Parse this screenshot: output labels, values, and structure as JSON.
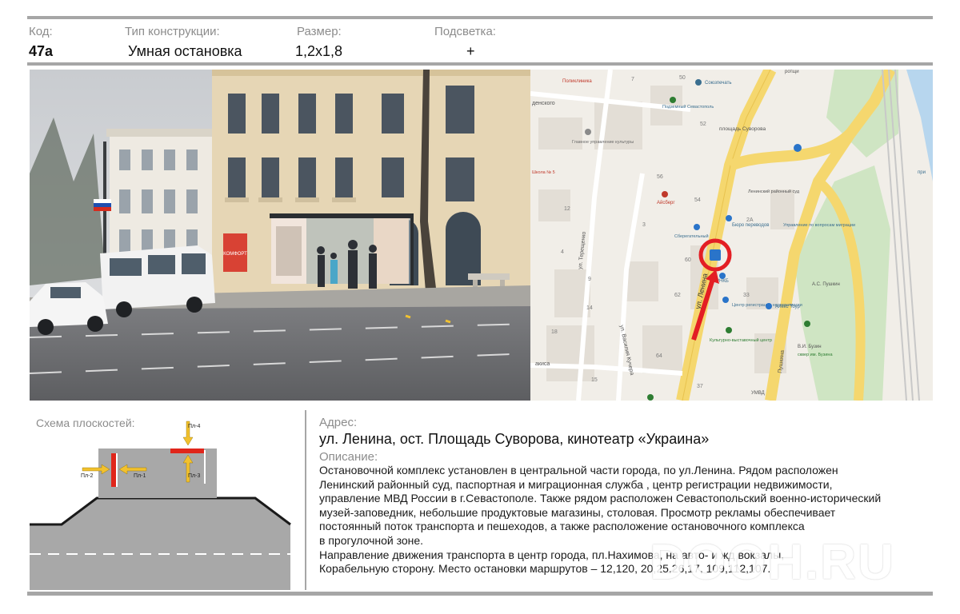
{
  "header": {
    "code_label": "Код:",
    "code_value": "47а",
    "type_label": "Тип конструкции:",
    "type_value": "Умная остановка",
    "size_label": "Размер:",
    "size_value": "1,2х1,8",
    "light_label": "Подсветка:",
    "light_value": "+"
  },
  "photo": {
    "storefront_sign": "КОМФОРТ"
  },
  "map": {
    "labels": {
      "poliklinika": "Поликлиника",
      "soyuzpechat": "Союзпечать",
      "podzemny": "Подземный Севастополь",
      "glavnoe": "Главное управление культуры",
      "ploshchad": "площадь Суворова",
      "school": "Школа № 5",
      "aysberg": "Айсберг",
      "leninsky": "Ленинский районный суд",
      "byuro": "Бюро переводов",
      "upravlenie": "Управление по вопросам миграции",
      "sberegatelny": "Сберегательный",
      "rnkb": "РНКБ",
      "tsentr": "Центр регистрации недвижимости",
      "alex": "Алекс Тоур",
      "kulturno": "Культурно-выставочный центр",
      "pushkin": "А.С. Пушкин",
      "buzin": "В.И. Бузин",
      "skver": "сквер им. Бузина",
      "umvd": "УМВД",
      "street_tereshchenko": "ул. Терещенко",
      "street_kuchera": "ул. Василия Кучера",
      "street_lenina": "ул. Ленина",
      "street_pushkina": "Пушкина",
      "street_denskogo": "денского",
      "street_akisa": "акиса",
      "side_pri": "при",
      "side_rotshi": "ротщи"
    },
    "house_numbers": [
      "7",
      "50",
      "52",
      "56",
      "54",
      "60",
      "62",
      "64",
      "37",
      "33",
      "2А",
      "9",
      "18",
      "14",
      "15",
      "12",
      "4",
      "3"
    ]
  },
  "schema": {
    "title": "Схема плоскостей:",
    "planes": {
      "p1": "Пл-1",
      "p2": "Пл-2",
      "p3": "Пл-3",
      "p4": "Пл-4"
    }
  },
  "address": {
    "label": "Адрес:",
    "value": "ул. Ленина, ост. Площадь Суворова, кинотеатр «Украина»"
  },
  "description": {
    "label": "Описание:",
    "lines": [
      "Остановочной комплекс установлен в центральной части города, по ул.Ленина. Рядом расположен",
      "Ленинский районный суд, паспортная и миграционная служба , центр регистрации недвижимости,",
      "управление МВД России в г.Севастополе. Также рядом расположен  Севастопольский военно-исторический",
      "музей-заповедник, небольшие продуктовые магазины, столовая. Просмотр рекламы обеспечивает",
      "постоянный поток транспорта и пешеходов, а также расположение остановочного комплекса",
      "в прогулочной зоне.",
      "Направление движения транспорта в центр города, пл.Нахимова, на авто- и жд вокзалы,",
      "Корабельную сторону.  Место остановки маршрутов – 12,120, 20,25,26,17, 109,112,107."
    ]
  },
  "watermark": "DOOH.RU",
  "colors": {
    "rule": "#a6a6a6",
    "label_gray": "#8c8c8c",
    "plane_red": "#e0261b",
    "plane_arrow": "#f2c12e",
    "pin_red": "#e31e24",
    "map_road": "#f5d76e"
  }
}
